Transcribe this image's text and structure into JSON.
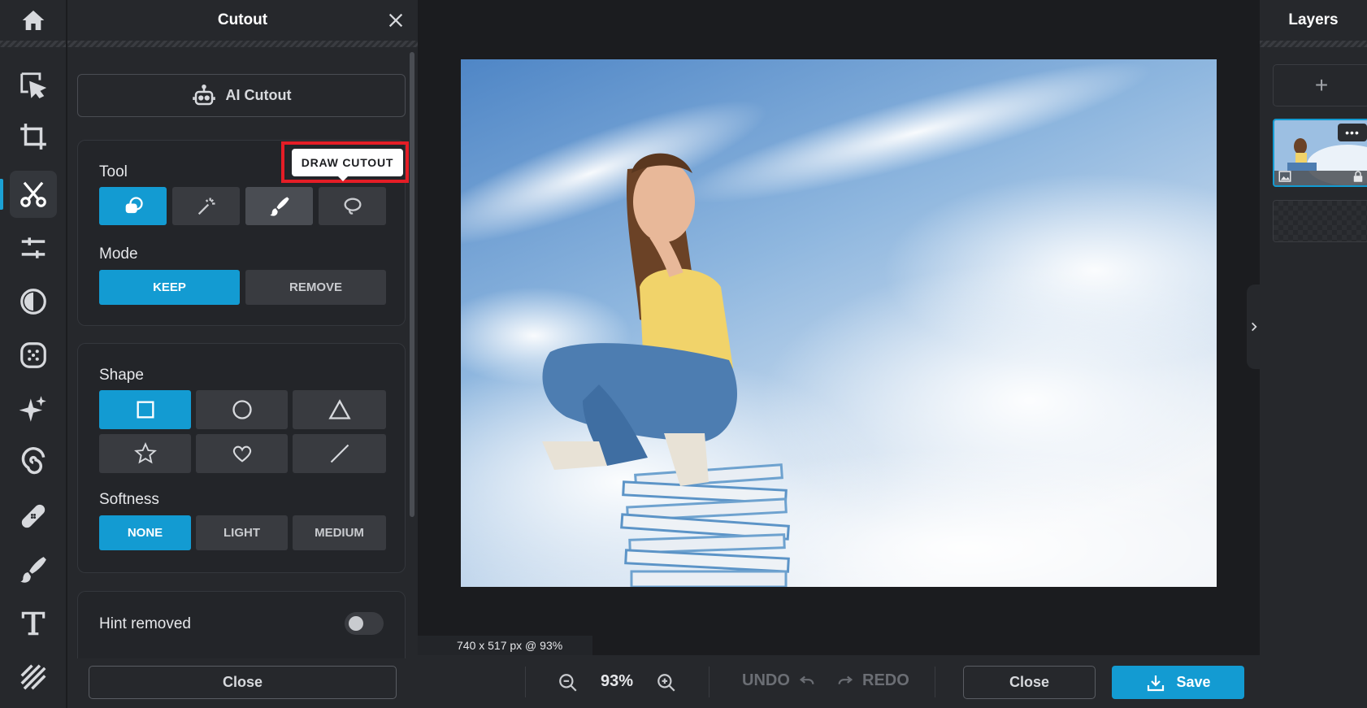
{
  "panel": {
    "title": "Cutout",
    "ai_cutout_label": "AI Cutout",
    "tool_label": "Tool",
    "tooltip": "DRAW CUTOUT",
    "mode_label": "Mode",
    "mode_options": [
      "KEEP",
      "REMOVE"
    ],
    "mode_selected": "KEEP",
    "shape_label": "Shape",
    "shapes": [
      "square-icon",
      "circle-icon",
      "triangle-icon",
      "star-icon",
      "heart-icon",
      "line-icon"
    ],
    "softness_label": "Softness",
    "softness_options": [
      "NONE",
      "LIGHT",
      "MEDIUM"
    ],
    "softness_selected": "NONE",
    "hint_removed_label": "Hint removed",
    "hint_removed_on": false,
    "close_label": "Close"
  },
  "toolbar": {
    "items": [
      "home-icon",
      "select-icon",
      "crop-icon",
      "cutout-icon",
      "adjust-icon",
      "contrast-icon",
      "effects-icon",
      "sparkle-icon",
      "swirl-icon",
      "bandage-icon",
      "brush-icon",
      "text-icon",
      "texture-icon"
    ],
    "active": "cutout-icon"
  },
  "canvas": {
    "dimensions": "740 x 517 px @ 93%"
  },
  "bottom": {
    "zoom": "93%",
    "undo_label": "UNDO",
    "redo_label": "REDO",
    "close_label": "Close",
    "save_label": "Save"
  },
  "layers": {
    "title": "Layers",
    "add_label": "+",
    "more_label": "•••"
  },
  "colors": {
    "accent": "#139bd2",
    "highlight": "#e51d26",
    "panel": "#26282c",
    "background": "#1b1c1f"
  }
}
